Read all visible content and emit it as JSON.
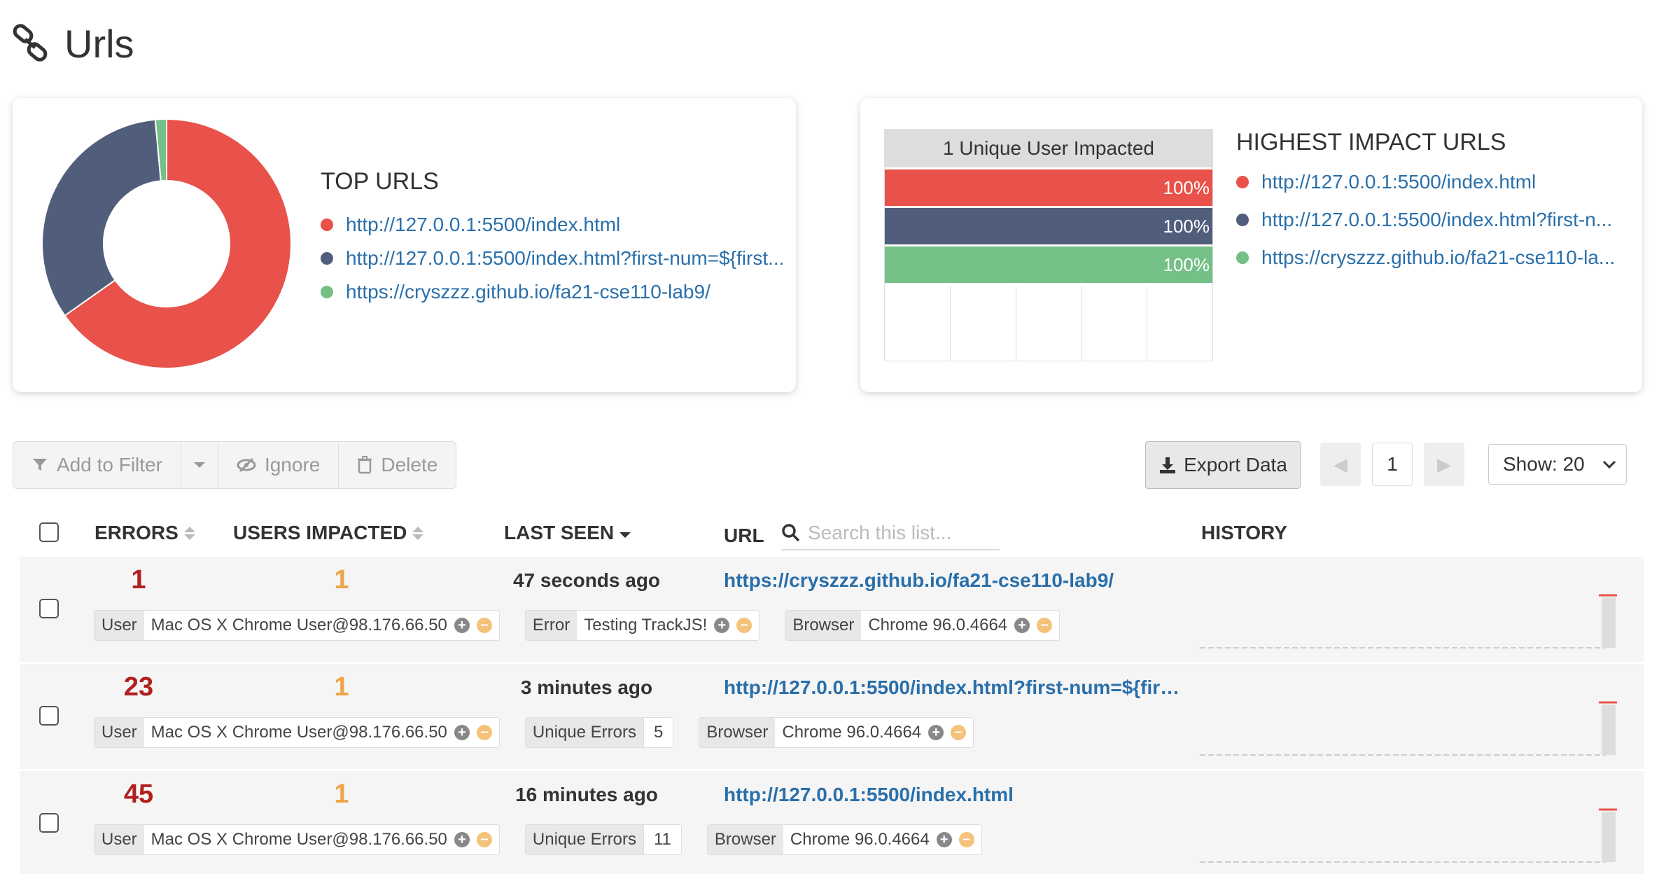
{
  "page": {
    "title": "Urls"
  },
  "top_urls": {
    "title": "TOP URLS",
    "items": [
      {
        "label": "http://127.0.0.1:5500/index.html",
        "color": "#e8524a"
      },
      {
        "label": "http://127.0.0.1:5500/index.html?first-num=${first...",
        "color": "#505e7c"
      },
      {
        "label": "https://cryszzz.github.io/fa21-cse110-lab9/",
        "color": "#74c086"
      }
    ]
  },
  "highest_impact": {
    "title": "HIGHEST IMPACT URLS",
    "items": [
      {
        "label": "http://127.0.0.1:5500/index.html",
        "color": "#e8524a"
      },
      {
        "label": "http://127.0.0.1:5500/index.html?first-n...",
        "color": "#505e7c"
      },
      {
        "label": "https://cryszzz.github.io/fa21-cse110-la...",
        "color": "#74c086"
      }
    ]
  },
  "chart_data": [
    {
      "type": "pie",
      "categories": [
        "http://127.0.0.1:5500/index.html",
        "http://127.0.0.1:5500/index.html?first-num=${fir...",
        "https://cryszzz.github.io/fa21-cse110-lab9/"
      ],
      "values": [
        45,
        23,
        1
      ],
      "colors": [
        "#e8524a",
        "#505e7c",
        "#74c086"
      ],
      "donut": true
    },
    {
      "type": "bar",
      "title": "1 Unique User Impacted",
      "categories": [
        "http://127.0.0.1:5500/index.html",
        "http://127.0.0.1:5500/index.html?first-n...",
        "https://cryszzz.github.io/fa21-cse110-la..."
      ],
      "values": [
        100,
        100,
        100
      ],
      "labels": [
        "100%",
        "100%",
        "100%"
      ],
      "colors": [
        "#e8524a",
        "#505e7c",
        "#74c086"
      ],
      "orientation": "horizontal"
    }
  ],
  "toolbar": {
    "add_filter": "Add to Filter",
    "ignore": "Ignore",
    "delete": "Delete",
    "export": "Export Data",
    "page": "1",
    "show": "Show: 20"
  },
  "table": {
    "headers": {
      "errors": "ERRORS",
      "users": "USERS IMPACTED",
      "last_seen": "LAST SEEN",
      "url": "URL",
      "history": "HISTORY"
    },
    "search_placeholder": "Search this list...",
    "rows": [
      {
        "errors": "1",
        "users": "1",
        "last_seen": "47 seconds ago",
        "url": "https://cryszzz.github.io/fa21-cse110-lab9/",
        "tags": [
          {
            "key": "User",
            "value": "Mac OS X Chrome User@98.176.66.50"
          },
          {
            "key": "Error",
            "value": "Testing TrackJS!"
          },
          {
            "key": "Browser",
            "value": "Chrome 96.0.4664"
          }
        ]
      },
      {
        "errors": "23",
        "users": "1",
        "last_seen": "3 minutes ago",
        "url": "http://127.0.0.1:5500/index.html?first-num=${first...",
        "tags": [
          {
            "key": "User",
            "value": "Mac OS X Chrome User@98.176.66.50"
          },
          {
            "key": "Unique Errors",
            "count": "5"
          },
          {
            "key": "Browser",
            "value": "Chrome 96.0.4664"
          }
        ]
      },
      {
        "errors": "45",
        "users": "1",
        "last_seen": "16 minutes ago",
        "url": "http://127.0.0.1:5500/index.html",
        "tags": [
          {
            "key": "User",
            "value": "Mac OS X Chrome User@98.176.66.50"
          },
          {
            "key": "Unique Errors",
            "count": "11"
          },
          {
            "key": "Browser",
            "value": "Chrome 96.0.4664"
          }
        ]
      }
    ]
  }
}
